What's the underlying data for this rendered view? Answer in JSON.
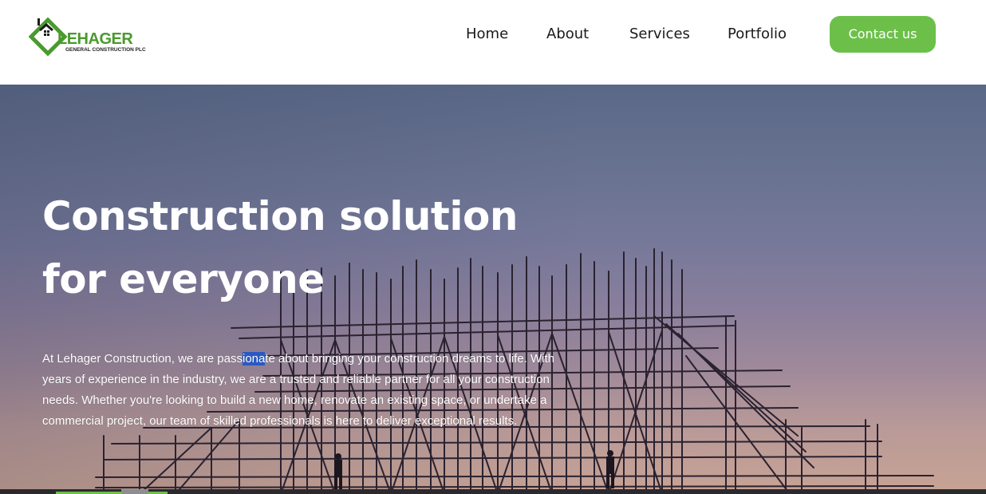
{
  "brand": {
    "logo_word": "LEHAGER",
    "logo_subtitle": "GENERAL CONSTRUCTION PLC",
    "primary_color": "#6cc04a"
  },
  "nav": {
    "items": [
      {
        "label": "Home"
      },
      {
        "label": "About"
      },
      {
        "label": "Services"
      },
      {
        "label": "Portfolio"
      }
    ],
    "contact_label": "Contact us"
  },
  "hero": {
    "title_line1": "Construction solution",
    "title_line2": "for everyone",
    "description_before": "At Lehager Construction, we are pass",
    "description_highlight": "iona",
    "description_after": "te about bringing your construction dreams to life. With years of experience in the industry, we are a trusted and reliable partner for all your construction needs. Whether you're looking to build a new home, renovate an existing space, or undertake a commercial project, our team of skilled professionals is here to deliver exceptional results.",
    "background_icon": "scaffolding-silhouette"
  }
}
